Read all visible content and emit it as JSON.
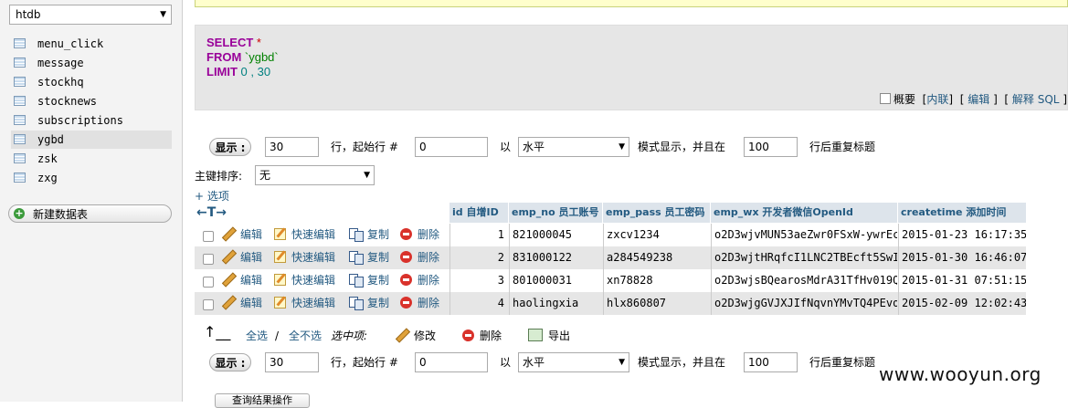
{
  "sidebar": {
    "database": "htdb",
    "tables": [
      {
        "label": "menu_click",
        "active": false
      },
      {
        "label": "message",
        "active": false
      },
      {
        "label": "stockhq",
        "active": false
      },
      {
        "label": "stocknews",
        "active": false
      },
      {
        "label": "subscriptions",
        "active": false
      },
      {
        "label": "ygbd",
        "active": true
      },
      {
        "label": "zsk",
        "active": false
      },
      {
        "label": "zxg",
        "active": false
      }
    ],
    "new_table": "新建数据表"
  },
  "sql": {
    "select": "SELECT",
    "select_rest": " *",
    "from": "FROM",
    "from_rest": " `ygbd`",
    "limit": "LIMIT",
    "limit_rest": " 0 , 30"
  },
  "sql_tools": {
    "profiling": "概要",
    "inline": "内联",
    "edit": "编辑",
    "explain": "解释 SQL",
    "bracket_open": "[",
    "bracket_close": "]"
  },
  "nav": {
    "show_button": "显示 :",
    "rows": "30",
    "from_label": "行，起始行 #",
    "start": "0",
    "in_label": "以",
    "mode": "水平",
    "mode_label": "模式显示，并且在",
    "repeat": "100",
    "repeat_label": "行后重复标题"
  },
  "sort": {
    "label": "主键排序:",
    "value": "无"
  },
  "options_link": "+ 选项",
  "table": {
    "arrows": "←T→",
    "columns": [
      "id 自增ID",
      "emp_no 员工账号",
      "emp_pass 员工密码",
      "emp_wx 开发者微信OpenId",
      "createtime 添加时间"
    ],
    "actions": {
      "edit": "编辑",
      "quick_edit": "快速编辑",
      "copy": "复制",
      "delete": "删除"
    },
    "rows": [
      {
        "id": "1",
        "emp_no": "821000045",
        "emp_pass": "zxcv1234",
        "emp_wx": "o2D3wjvMUN53aeZwr0FSxW-ywrEc",
        "createtime": "2015-01-23 16:17:35"
      },
      {
        "id": "2",
        "emp_no": "831000122",
        "emp_pass": "a284549238",
        "emp_wx": "o2D3wjtHRqfcI1LNC2TBEcft5SwI",
        "createtime": "2015-01-30 16:46:07"
      },
      {
        "id": "3",
        "emp_no": "801000031",
        "emp_pass": "xn78828",
        "emp_wx": "o2D3wjsBQearosMdrA31TfHv019Q",
        "createtime": "2015-01-31 07:51:15"
      },
      {
        "id": "4",
        "emp_no": "haolingxia",
        "emp_pass": "hlx860807",
        "emp_wx": "o2D3wjgGVJXJIfNqvnYMvTQ4PEvo",
        "createtime": "2015-02-09 12:02:43"
      }
    ]
  },
  "bulk": {
    "select_all": "全选",
    "separator": "/",
    "deselect_all": "全不选",
    "with_selected": "选中项:",
    "modify": "修改",
    "delete": "删除",
    "export": "导出"
  },
  "watermark": "www.wooyun.org",
  "bottom_button": "查询结果操作"
}
